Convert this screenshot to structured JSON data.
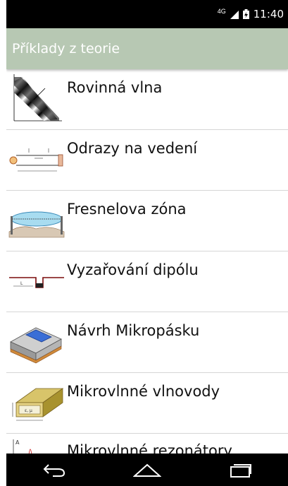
{
  "status_bar": {
    "network": "4G",
    "time": "11:40"
  },
  "action_bar": {
    "title": "Příklady z teorie"
  },
  "items": [
    {
      "label": "Rovinná vlna",
      "icon": "plane-wave-icon"
    },
    {
      "label": "Odrazy na vedení",
      "icon": "transmission-line-icon"
    },
    {
      "label": "Fresnelova zóna",
      "icon": "fresnel-zone-icon"
    },
    {
      "label": "Vyzařování dipólu",
      "icon": "dipole-icon"
    },
    {
      "label": "Návrh Mikropásku",
      "icon": "microstrip-icon"
    },
    {
      "label": "Mikrovlnné vlnovody",
      "icon": "waveguide-icon"
    },
    {
      "label": "Mikrovlnné rezonátory",
      "icon": "resonator-icon"
    }
  ],
  "nav": {
    "back_icon": "back-icon",
    "home_icon": "home-icon",
    "recents_icon": "recents-icon"
  }
}
